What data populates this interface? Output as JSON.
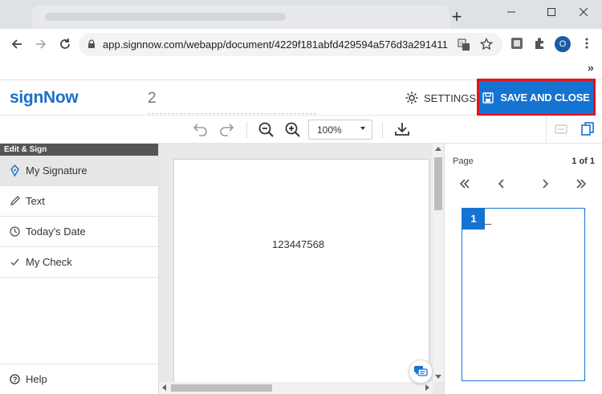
{
  "browser": {
    "new_tab_symbol": "+",
    "url": "app.signnow.com/webapp/document/4229f181abfd429594a576d3a291411...",
    "profile_initial": "O",
    "bookmarks_overflow": "»"
  },
  "app": {
    "logo": "signNow",
    "document_number": "2",
    "settings_label": "SETTINGS",
    "save_close_label": "SAVE AND CLOSE",
    "accent_color": "#1573d1",
    "highlight_color": "#e8101a"
  },
  "toolbar": {
    "zoom_value": "100%"
  },
  "sidebar": {
    "header": "Edit & Sign",
    "items": [
      {
        "label": "My Signature",
        "icon": "pen-nib-icon",
        "active": true
      },
      {
        "label": "Text",
        "icon": "pencil-icon"
      },
      {
        "label": "Today's Date",
        "icon": "clock-icon"
      },
      {
        "label": "My Check",
        "icon": "checkmark-icon"
      }
    ],
    "help_label": "Help"
  },
  "document": {
    "text": "123447568"
  },
  "pages_panel": {
    "label": "Page",
    "count": "1 of 1",
    "thumbnail_number": "1"
  }
}
